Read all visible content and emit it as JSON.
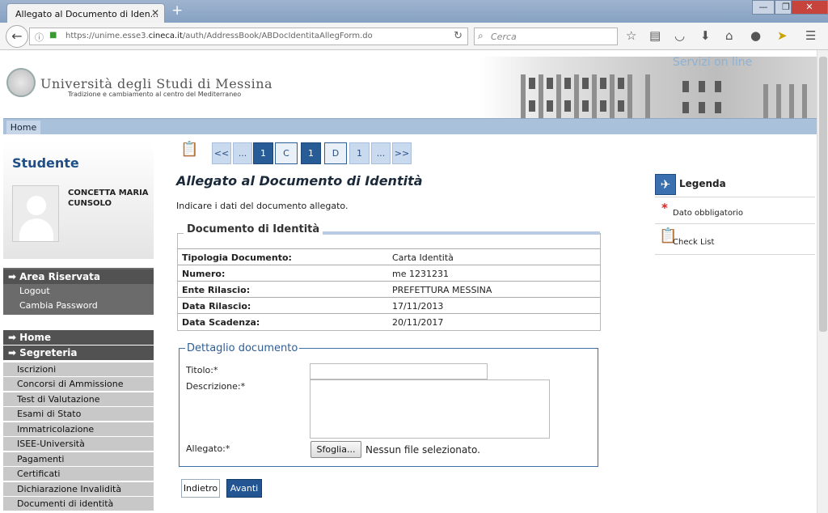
{
  "browser": {
    "tab_title": "Allegato al Documento di Iden...",
    "tab_close": "✕",
    "new_tab": "+",
    "url_host_prefix": "https://unime.esse3.",
    "url_host": "cineca.it",
    "url_path": "/auth/AddressBook/ABDocIdentitaAllegForm.do",
    "search_placeholder": "Cerca"
  },
  "header": {
    "university_name": "Università degli Studi di Messina",
    "motto": "Tradizione e cambiamento al centro del Mediterraneo",
    "servizi": "Servizi on line"
  },
  "topnav": {
    "home": "Home"
  },
  "sidebar": {
    "title": "Studente",
    "student_name": "CONCETTA MARIA CUNSOLO",
    "area_riservata": "Area Riservata",
    "logout": "Logout",
    "cambia_password": "Cambia Password",
    "home": "Home",
    "segreteria": "Segreteria",
    "menu": [
      "Iscrizioni",
      "Concorsi di Ammissione",
      "Test di Valutazione",
      "Esami di Stato",
      "Immatricolazione",
      "ISEE-Università",
      "Pagamenti",
      "Certificati",
      "Dichiarazione Invalidità",
      "Documenti di identità"
    ]
  },
  "pager": [
    "<<",
    "...",
    "1",
    "C",
    "1",
    "D",
    "1",
    "...",
    ">>"
  ],
  "main": {
    "title": "Allegato al Documento di Identità",
    "intro": "Indicare i dati del documento allegato."
  },
  "documento": {
    "legend": "Documento di Identità",
    "rows": [
      {
        "label": "Tipologia Documento:",
        "value": "Carta Identità"
      },
      {
        "label": "Numero:",
        "value": "me 1231231"
      },
      {
        "label": "Ente Rilascio:",
        "value": "PREFETTURA MESSINA"
      },
      {
        "label": "Data Rilascio:",
        "value": "17/11/2013"
      },
      {
        "label": "Data Scadenza:",
        "value": "20/11/2017"
      }
    ]
  },
  "dettaglio": {
    "legend": "Dettaglio documento",
    "titolo_label": "Titolo:*",
    "titolo_value": "",
    "descrizione_label": "Descrizione:*",
    "descrizione_value": "",
    "allegato_label": "Allegato:*",
    "browse_label": "Sfoglia...",
    "no_file": "Nessun file selezionato."
  },
  "buttons": {
    "indietro": "Indietro",
    "avanti": "Avanti"
  },
  "legenda": {
    "title": "Legenda",
    "required": "Dato obbligatorio",
    "checklist": "Check List"
  },
  "colors": {
    "brand_blue": "#225592",
    "nav_blue": "#a9c1db",
    "sidebar_dark": "#525252"
  }
}
